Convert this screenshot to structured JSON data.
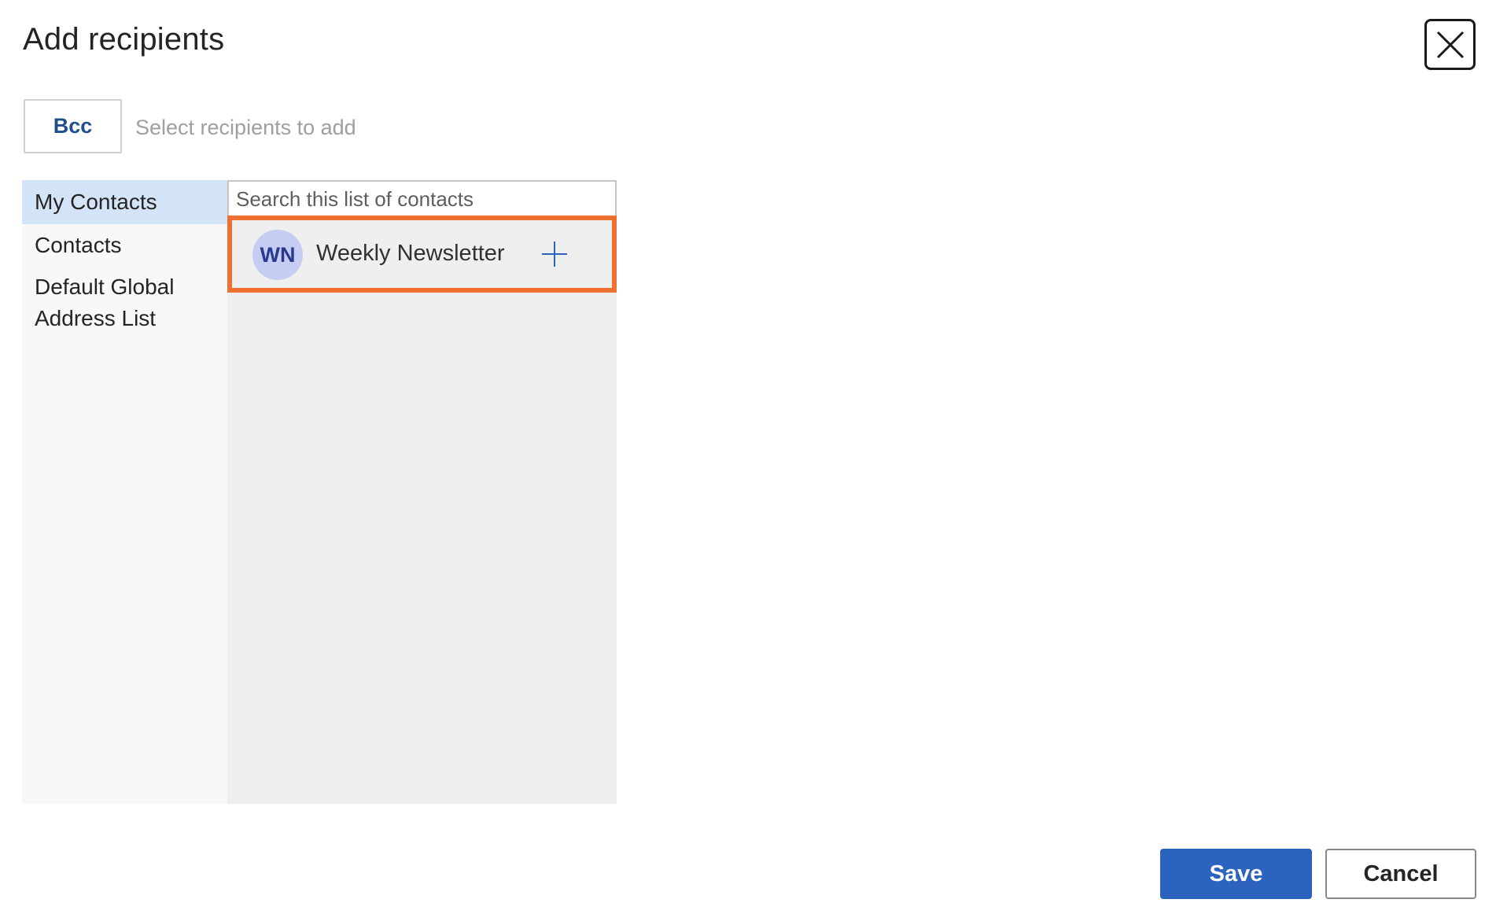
{
  "dialog": {
    "title": "Add recipients"
  },
  "recipients": {
    "field_label": "Bcc",
    "placeholder": "Select recipients to add"
  },
  "sidebar": {
    "items": [
      {
        "label": "My Contacts",
        "selected": true
      },
      {
        "label": "Contacts",
        "selected": false
      },
      {
        "label": "Default Global Address List",
        "selected": false
      }
    ]
  },
  "contact_list": {
    "search_placeholder": "Search this list of contacts",
    "contacts": [
      {
        "initials": "WN",
        "name": "Weekly Newsletter",
        "highlighted": true
      }
    ]
  },
  "footer": {
    "save_label": "Save",
    "cancel_label": "Cancel"
  },
  "colors": {
    "primary": "#2b63be",
    "highlight": "#ef7030",
    "selected_nav": "#d3e3f8",
    "avatar_bg": "#c5cdf3"
  },
  "icons": {
    "close": "close-icon",
    "add": "plus-icon"
  }
}
